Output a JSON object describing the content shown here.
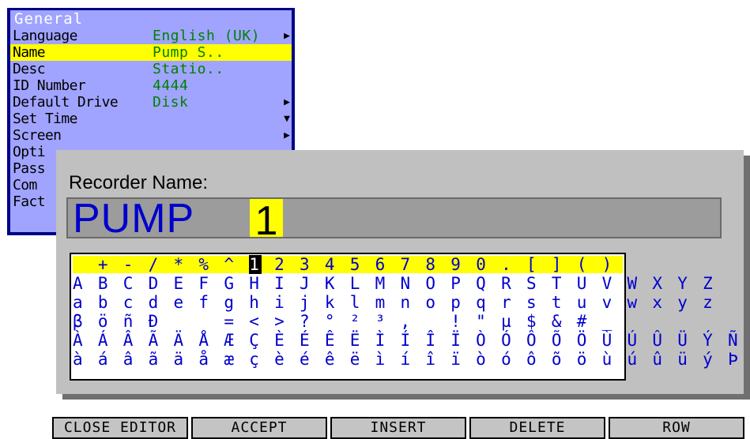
{
  "menu": {
    "title": "General",
    "rows": [
      {
        "label": "Language",
        "value": "English (UK)",
        "arrow": "▶"
      },
      {
        "label": "Name",
        "value": "Pump S..",
        "arrow": ""
      },
      {
        "label": "Desc",
        "value": "Statio..",
        "arrow": ""
      },
      {
        "label": "ID Number",
        "value": "4444",
        "arrow": ""
      },
      {
        "label": "Default Drive",
        "value": "Disk",
        "arrow": "▶"
      },
      {
        "label": "Set Time",
        "value": "",
        "arrow": "▼"
      },
      {
        "label": "Screen",
        "value": "",
        "arrow": "▶"
      },
      {
        "label": "Opti",
        "value": "",
        "arrow": ""
      },
      {
        "label": "Pass",
        "value": "",
        "arrow": ""
      },
      {
        "label": "Com",
        "value": "",
        "arrow": ""
      },
      {
        "label": "Fact",
        "value": "",
        "arrow": ""
      }
    ]
  },
  "editor": {
    "label": "Recorder Name:",
    "name_value": "PUMP",
    "cursor_char": "1",
    "charset": {
      "row1_before": "  + - / * % ^ ",
      "row1_selected": "1",
      "row1_after": " 2 3 4 5 6 7 8 9 0 . [ ] ( )",
      "row2": "A B C D E F G H I J K L M N O P Q R S T U V W X Y Z",
      "row3": "a b c d e f g h i j k l m n o p q r s t u v w x y z",
      "row4": "β ö ñ Đ     = < > ? ° ² ³ ,   ! \" µ $ & # _",
      "row5": "À Á Â Ã Ä Å Æ Ç È É Ê Ë Ì Í Î Ï Ò Ó Ô Õ Ö Ù Ú Û Ü Ý Ñ",
      "row6": "à á â ã ä å æ ç è é ê ë ì í î ï ò ó ô õ ö ù ú û ü ý Þ"
    }
  },
  "softkeys": {
    "close_editor": "CLOSE EDITOR",
    "accept": "ACCEPT",
    "insert": "INSERT",
    "delete": "DELETE",
    "row": "ROW"
  }
}
